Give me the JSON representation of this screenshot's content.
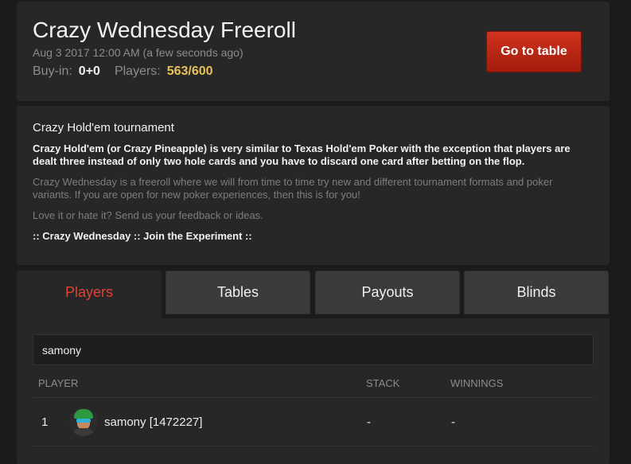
{
  "header": {
    "title": "Crazy Wednesday Freeroll",
    "date": "Aug 3 2017 12:00 AM (a few seconds ago)",
    "buyin_label": "Buy-in:",
    "buyin_value": "0+0",
    "players_label": "Players:",
    "players_value": "563/600",
    "go_button": "Go to table"
  },
  "description": {
    "title": "Crazy Hold'em tournament",
    "bold_text": "Crazy Hold'em (or Crazy Pineapple) is very similar to Texas Hold'em Poker with the exception that players are dealt three instead of only two hole cards and you have to discard one card after betting on the flop.",
    "gray_text": "Crazy Wednesday is a freeroll where we will from time to time try new and different tournament formats and poker variants. If you are open for new poker experiences, then this is for you!",
    "feedback_text": "Love it or hate it? Send us your feedback or ideas.",
    "tagline": ":: Crazy Wednesday :: Join the Experiment ::"
  },
  "tabs": [
    {
      "label": "Players"
    },
    {
      "label": "Tables"
    },
    {
      "label": "Payouts"
    },
    {
      "label": "Blinds"
    }
  ],
  "players": {
    "search_value": "samony",
    "columns": {
      "player": "PLAYER",
      "stack": "STACK",
      "winnings": "WINNINGS"
    },
    "rows": [
      {
        "rank": "1",
        "name": "samony [1472227]",
        "stack": "-",
        "winnings": "-"
      }
    ]
  },
  "colors": {
    "accent_red": "#dd4436",
    "gold": "#e8c05a",
    "button": "#c0291a"
  }
}
